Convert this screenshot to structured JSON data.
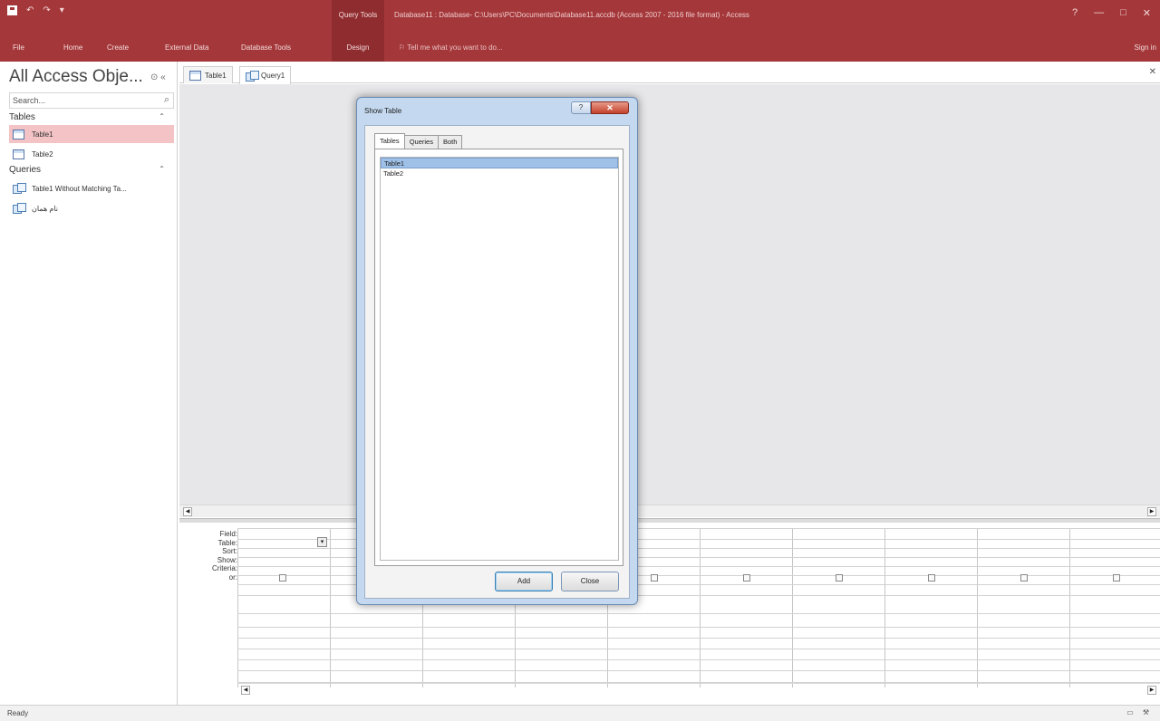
{
  "window": {
    "title": "Database11 : Database- C:\\Users\\PC\\Documents\\Database11.accdb (Access 2007 - 2016 file format) - Access",
    "controls": [
      "?",
      "—",
      "□",
      "✕"
    ],
    "context_label": "Query Tools"
  },
  "ribbon": {
    "tabs": [
      "File",
      "Home",
      "Create",
      "External Data",
      "Database Tools"
    ],
    "design_tab": "Design",
    "tell_me": "Tell me what you want to do...",
    "sign_in": "Sign in"
  },
  "nav": {
    "title": "All Access Obje...",
    "search_placeholder": "Search...",
    "groups": [
      {
        "label": "Tables",
        "items": [
          "Table1",
          "Table2"
        ]
      },
      {
        "label": "Queries",
        "items": [
          "Table1 Without Matching Ta...",
          "نام همان"
        ]
      }
    ]
  },
  "doc_tabs": [
    {
      "label": "Table1",
      "active": false
    },
    {
      "label": "Query1",
      "active": true
    }
  ],
  "grid": {
    "row_labels": [
      "Field:",
      "Table:",
      "Sort:",
      "Show:",
      "Criteria:",
      "or:"
    ]
  },
  "status": {
    "text": "Ready"
  },
  "dialog": {
    "title": "Show Table",
    "help": "?",
    "close": "✕",
    "tabs": [
      "Tables",
      "Queries",
      "Both"
    ],
    "active_tab": "Tables",
    "list": [
      "Table1",
      "Table2"
    ],
    "selected": "Table1",
    "add_label": "Add",
    "close_label": "Close"
  },
  "colors": {
    "ribbon": "#a4373a",
    "nav_selection": "#f3c3c5",
    "dialog_frame": "#c4d9ef"
  }
}
